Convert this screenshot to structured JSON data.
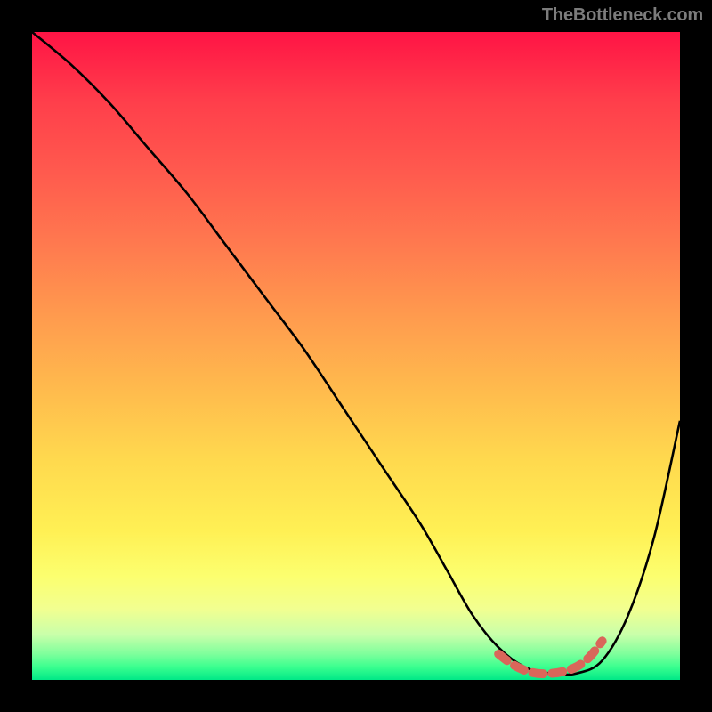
{
  "watermark": "TheBottleneck.com",
  "chart_data": {
    "type": "line",
    "title": "",
    "xlabel": "",
    "ylabel": "",
    "xlim": [
      0,
      100
    ],
    "ylim": [
      0,
      100
    ],
    "grid": false,
    "series": [
      {
        "name": "bottleneck-curve",
        "color": "#000000",
        "x": [
          0,
          6,
          12,
          18,
          24,
          30,
          36,
          42,
          48,
          54,
          60,
          64,
          68,
          72,
          76,
          80,
          84,
          88,
          92,
          96,
          100
        ],
        "y": [
          100,
          95,
          89,
          82,
          75,
          67,
          59,
          51,
          42,
          33,
          24,
          17,
          10,
          5,
          2,
          1,
          1,
          3,
          10,
          22,
          40
        ]
      },
      {
        "name": "highlight-band",
        "color": "#d9665a",
        "x": [
          72,
          74,
          76,
          78,
          80,
          82,
          84,
          86,
          88
        ],
        "y": [
          4.0,
          2.5,
          1.5,
          1.0,
          1.0,
          1.3,
          2.0,
          3.5,
          6.0
        ]
      }
    ]
  },
  "colors": {
    "background": "#000000",
    "curve": "#000000",
    "highlight": "#d9665a",
    "gradient_top": "#ff1445",
    "gradient_bottom": "#00e887",
    "watermark": "#7c7c7c"
  }
}
